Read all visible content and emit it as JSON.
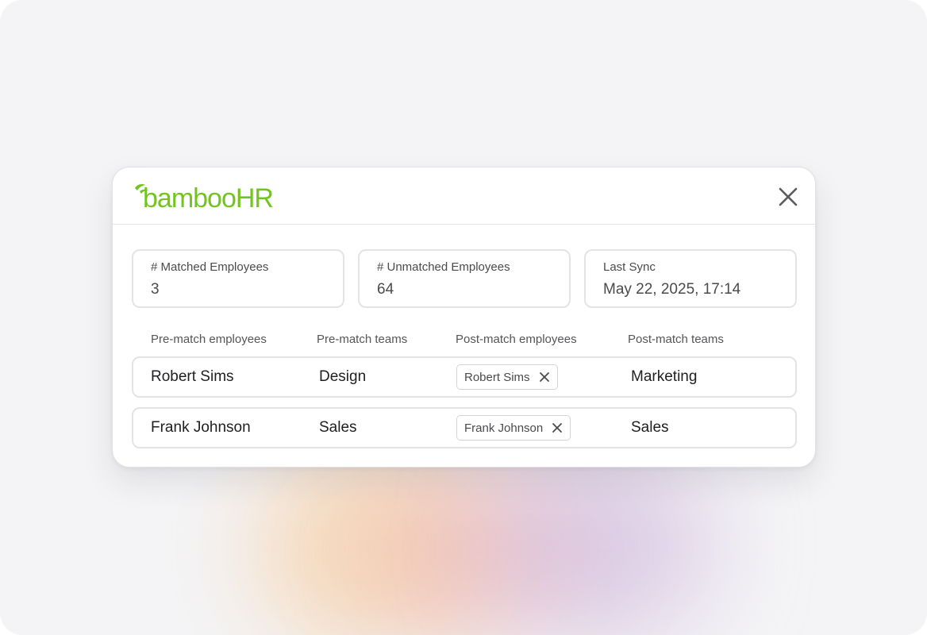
{
  "brand": {
    "logo_text": "bambooHR",
    "logo_color": "#73c41d"
  },
  "stats": [
    {
      "label": "# Matched Employees",
      "value": "3"
    },
    {
      "label": "# Unmatched Employees",
      "value": "64"
    },
    {
      "label": "Last Sync",
      "value": "May 22, 2025, 17:14"
    }
  ],
  "table": {
    "columns": [
      "Pre-match employees",
      "Pre-match teams",
      "Post-match employees",
      "Post-match teams"
    ],
    "rows": [
      {
        "pre_employee": "Robert Sims",
        "pre_team": "Design",
        "post_employee": "Robert Sims",
        "post_team": "Marketing"
      },
      {
        "pre_employee": "Frank Johnson",
        "pre_team": "Sales",
        "post_employee": "Frank Johnson",
        "post_team": "Sales"
      }
    ]
  },
  "icons": {
    "close": "close-icon",
    "chip_remove": "x-icon"
  }
}
